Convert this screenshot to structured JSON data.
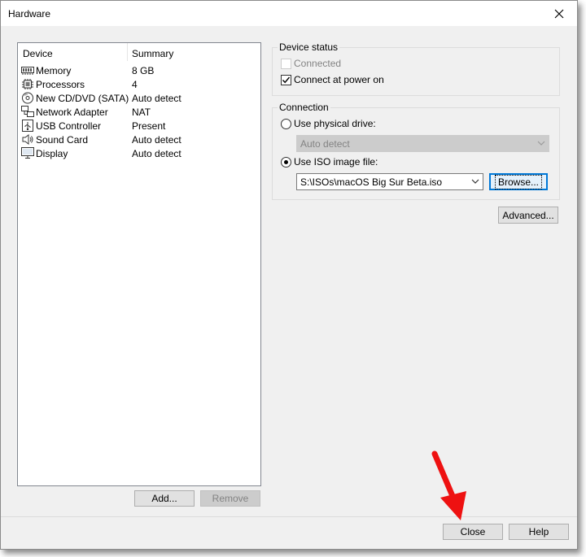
{
  "window": {
    "title": "Hardware",
    "close_glyph": "✕"
  },
  "device_list": {
    "columns": [
      "Device",
      "Summary"
    ],
    "rows": [
      {
        "icon": "memory-icon",
        "name": "Memory",
        "summary": "8 GB"
      },
      {
        "icon": "processor-icon",
        "name": "Processors",
        "summary": "4"
      },
      {
        "icon": "cd-dvd-icon",
        "name": "New CD/DVD (SATA)",
        "summary": "Auto detect"
      },
      {
        "icon": "network-adapter-icon",
        "name": "Network Adapter",
        "summary": "NAT"
      },
      {
        "icon": "usb-icon",
        "name": "USB Controller",
        "summary": "Present"
      },
      {
        "icon": "speaker-icon",
        "name": "Sound Card",
        "summary": "Auto detect"
      },
      {
        "icon": "display-icon",
        "name": "Display",
        "summary": "Auto detect"
      }
    ]
  },
  "buttons": {
    "add": "Add...",
    "remove": "Remove",
    "browse": "Browse...",
    "advanced": "Advanced...",
    "close": "Close",
    "help": "Help"
  },
  "device_status": {
    "label": "Device status",
    "connected_label": "Connected",
    "connected_checked": false,
    "connect_power_label": "Connect at power on",
    "connect_power_checked": true
  },
  "connection": {
    "label": "Connection",
    "physical_label": "Use physical drive:",
    "physical_value": "Auto detect",
    "iso_label": "Use ISO image file:",
    "iso_value": "S:\\ISOs\\macOS Big Sur Beta.iso",
    "selected": "iso"
  },
  "colors": {
    "annotation_arrow": "#ee1111",
    "focus": "#0078d7"
  }
}
